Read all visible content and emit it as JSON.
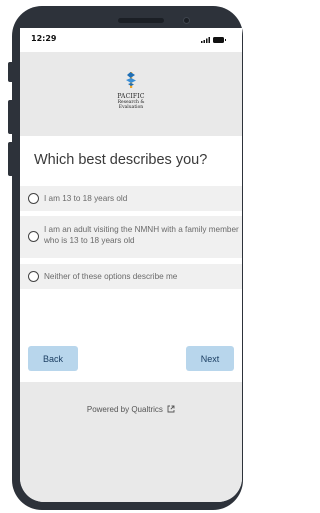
{
  "status_bar": {
    "time": "12:29",
    "signal_icon": "signal-icon",
    "battery_icon": "battery-icon"
  },
  "header": {
    "logo": {
      "line1": "PACIFIC",
      "line2": "Research &",
      "line3": "Evaluation",
      "icon": "pacific-logo-icon"
    }
  },
  "question": "Which best describes you?",
  "options": [
    {
      "label": "I am 13 to 18 years old",
      "selected": false
    },
    {
      "label": "I am an adult visiting the NMNH with a family member who is 13 to 18 years old",
      "selected": false
    },
    {
      "label": "Neither of these options describe me",
      "selected": false
    }
  ],
  "nav": {
    "back_label": "Back",
    "next_label": "Next"
  },
  "footer": {
    "powered_label": "Powered by Qualtrics",
    "external_link_icon": "external-link-icon"
  },
  "colors": {
    "button_bg": "#b8d6ec",
    "header_bg": "#e9e9e9",
    "option_bg": "#f0f0f0",
    "frame": "#2d323a"
  }
}
